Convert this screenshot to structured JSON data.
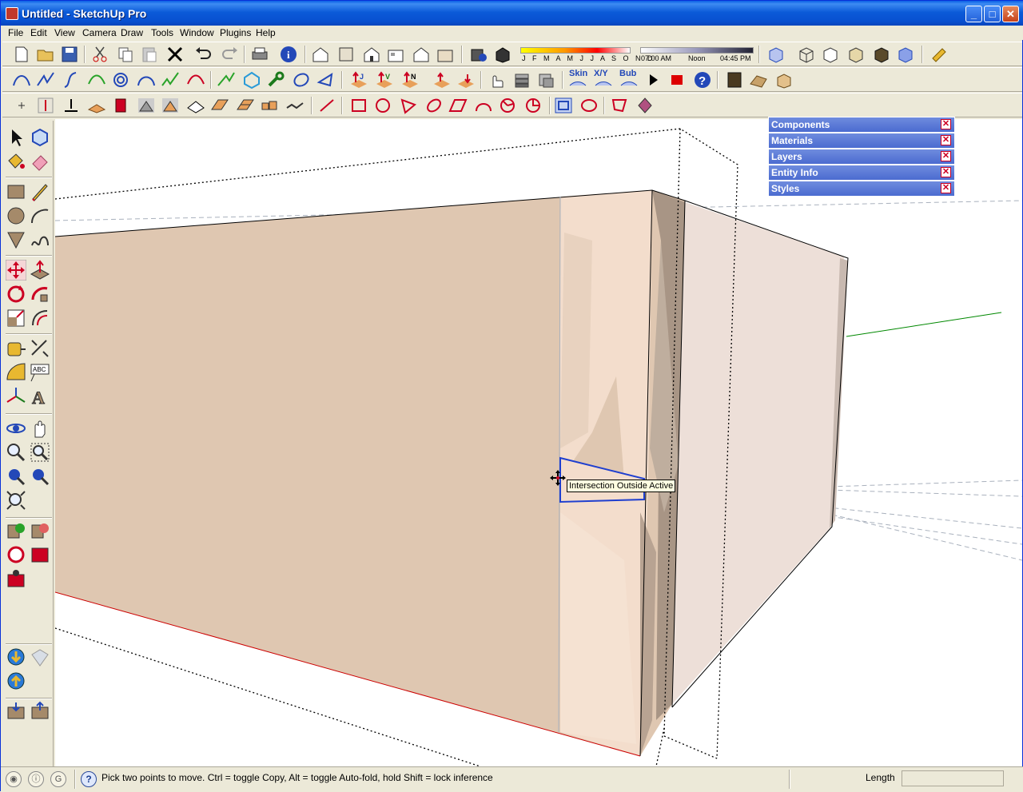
{
  "window": {
    "title": "Untitled - SketchUp Pro"
  },
  "menu": [
    {
      "label": "File"
    },
    {
      "label": "Edit"
    },
    {
      "label": "View"
    },
    {
      "label": "Camera"
    },
    {
      "label": "Draw"
    },
    {
      "label": "Tools"
    },
    {
      "label": "Window"
    },
    {
      "label": "Plugins"
    },
    {
      "label": "Help"
    }
  ],
  "shadow_settings": {
    "months": "J F M A M J J A S O N D",
    "time_start": "07:00 AM",
    "time_mid": "Noon",
    "time_end": "04:45 PM"
  },
  "plugin_labels": {
    "skin": "Skin",
    "xy": "X/Y",
    "bub": "Bub"
  },
  "tray": [
    {
      "label": "Components"
    },
    {
      "label": "Materials"
    },
    {
      "label": "Layers"
    },
    {
      "label": "Entity Info"
    },
    {
      "label": "Styles"
    }
  ],
  "tooltip": "Intersection Outside Active",
  "status": {
    "prompt": "Pick two points to move.  Ctrl = toggle Copy, Alt = toggle Auto-fold, hold Shift = lock inference",
    "measure_label": "Length",
    "measure_value": ""
  },
  "colors": {
    "titlebar": "#0a5fe6",
    "wall_front": "#dfc7b1",
    "wall_side": "#eddfd8",
    "selection": "#1f3fcf",
    "axis_red": "#cc0000",
    "axis_green": "#008800"
  }
}
